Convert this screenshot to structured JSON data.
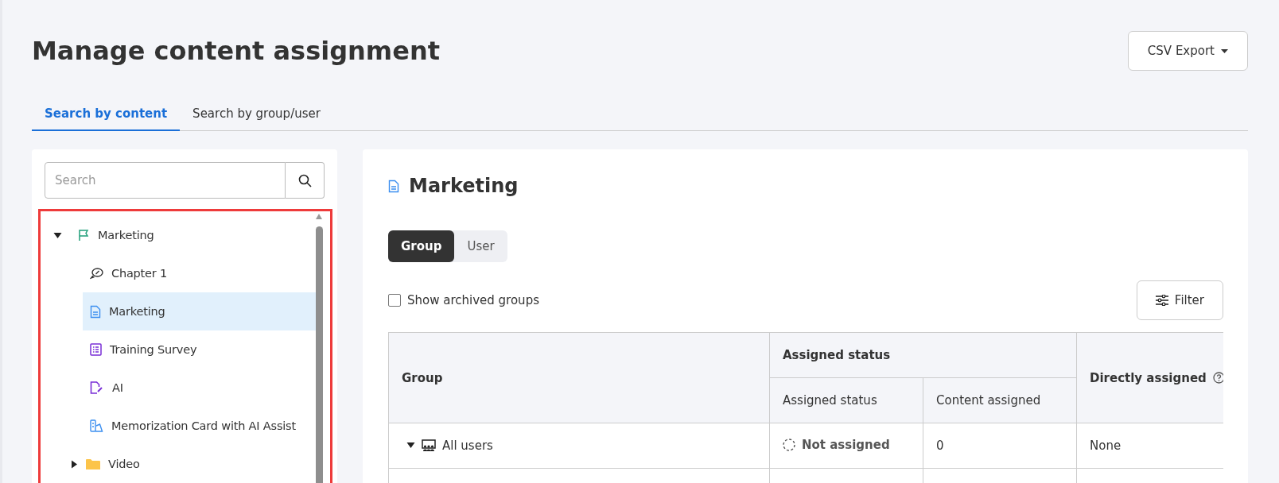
{
  "page": {
    "title": "Manage content assignment",
    "export_button": "CSV Export"
  },
  "tabs": [
    {
      "label": "Search by content",
      "selected": true
    },
    {
      "label": "Search by group/user",
      "selected": false
    }
  ],
  "sidebar": {
    "search": {
      "placeholder": "Search"
    },
    "tree": [
      {
        "label": "Marketing",
        "kind": "course",
        "expanded": true,
        "selected": false,
        "children": [
          {
            "label": "Chapter 1",
            "kind": "chapter",
            "selected": false
          },
          {
            "label": "Marketing",
            "kind": "document",
            "selected": true
          },
          {
            "label": "Training Survey",
            "kind": "survey",
            "selected": false
          },
          {
            "label": "AI",
            "kind": "ai",
            "selected": false
          },
          {
            "label": "Memorization Card with AI Assist",
            "kind": "card",
            "selected": false
          },
          {
            "label": "Video",
            "kind": "folder",
            "expanded": false,
            "selected": false
          }
        ]
      }
    ]
  },
  "detail": {
    "title": "Marketing",
    "segments": [
      {
        "label": "Group",
        "selected": true
      },
      {
        "label": "User",
        "selected": false
      }
    ],
    "show_archived": {
      "label": "Show archived groups",
      "checked": false
    },
    "filter_button": "Filter",
    "table": {
      "columns": {
        "group": "Group",
        "assigned_status": "Assigned status",
        "status": "Assigned status",
        "content_assigned": "Content assigned",
        "directly_assigned": "Directly assigned"
      },
      "rows": [
        {
          "group": "All users",
          "expanded": true,
          "status": {
            "label": "Not assigned",
            "kind": "not_assigned"
          },
          "content_assigned": "0",
          "directly_assigned": "None"
        }
      ]
    }
  }
}
